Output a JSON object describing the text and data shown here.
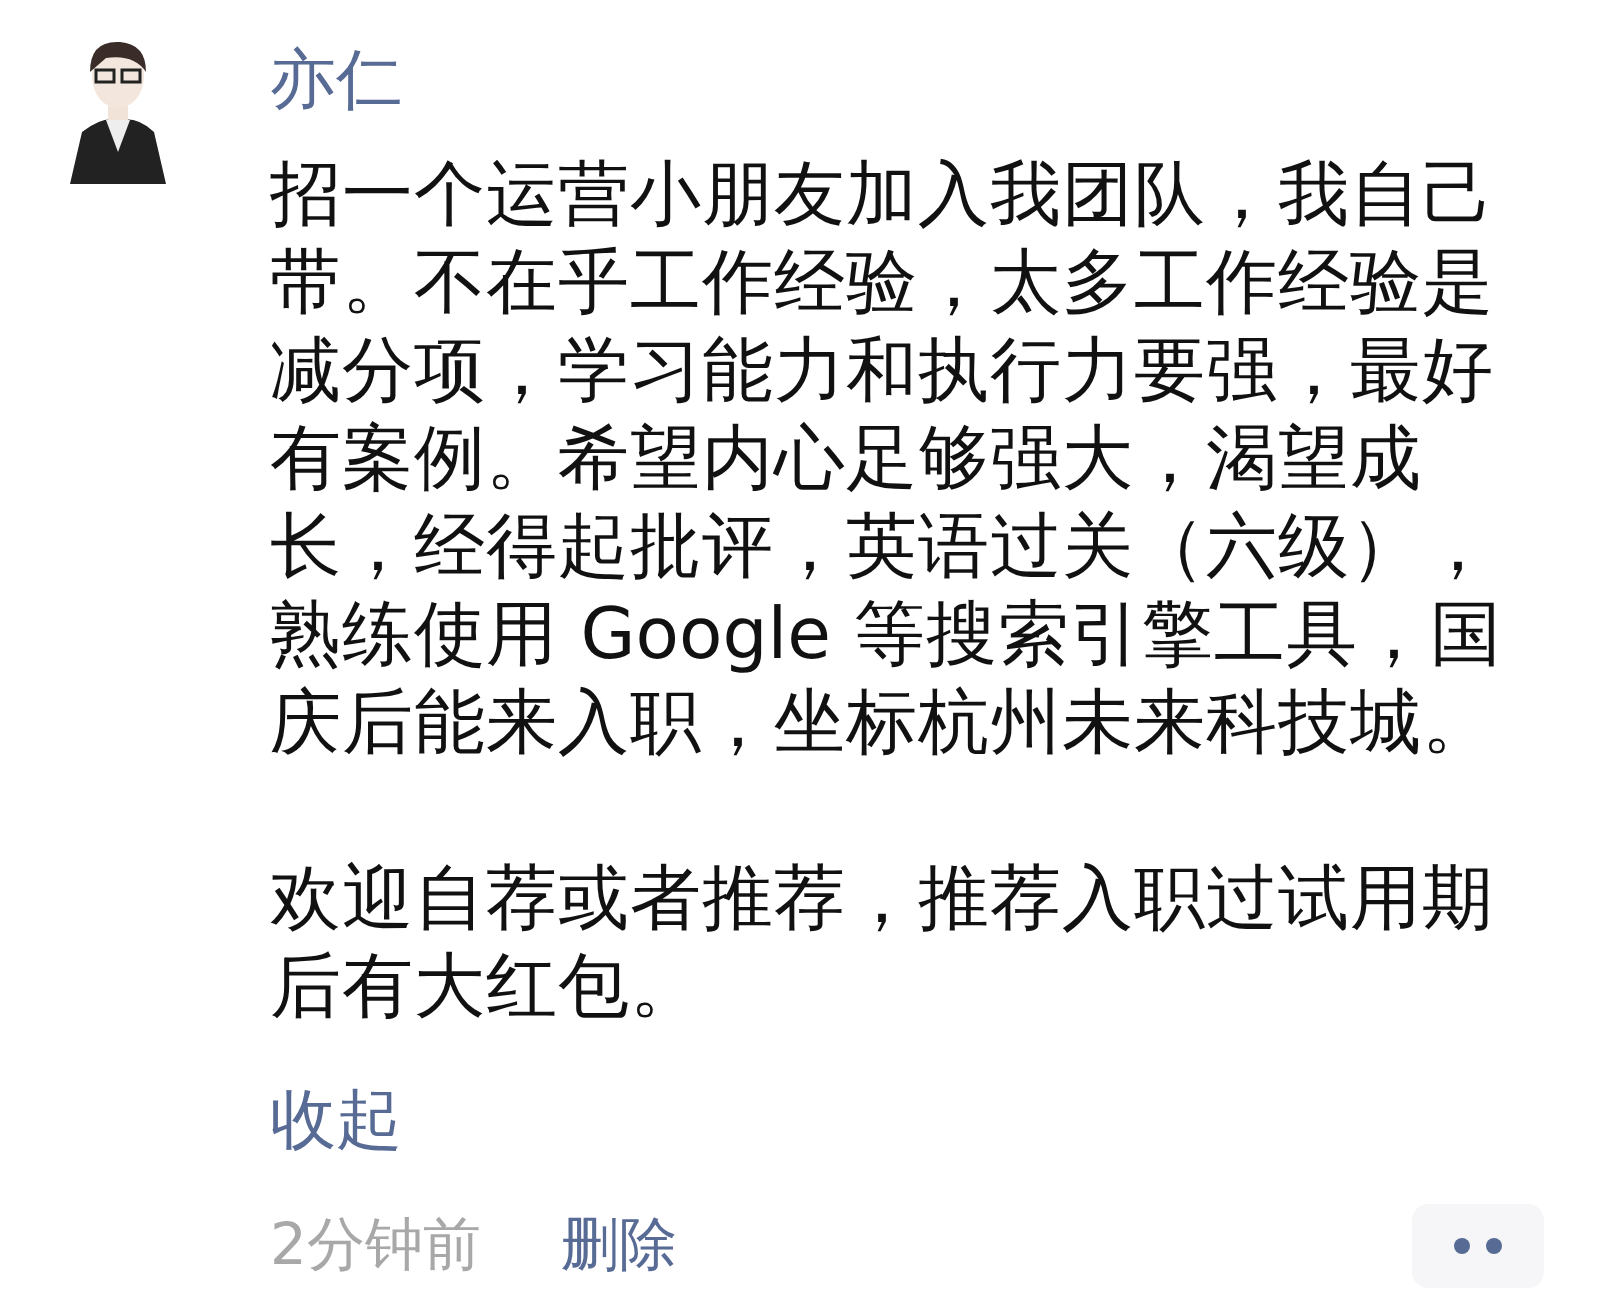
{
  "post": {
    "author": "亦仁",
    "paragraphs": [
      "招一个运营小朋友加入我团队，我自己带。不在乎工作经验，太多工作经验是减分项，学习能力和执行力要强，最好有案例。希望内心足够强大，渴望成长，经得起批评，英语过关（六级），熟练使用 Google 等搜索引擎工具，国庆后能来入职，坐标杭州未来科技城。",
      "欢迎自荐或者推荐，推荐入职过试用期后有大红包。"
    ],
    "collapse_link": "收起",
    "time": "2分钟前",
    "delete_link": "删除"
  }
}
